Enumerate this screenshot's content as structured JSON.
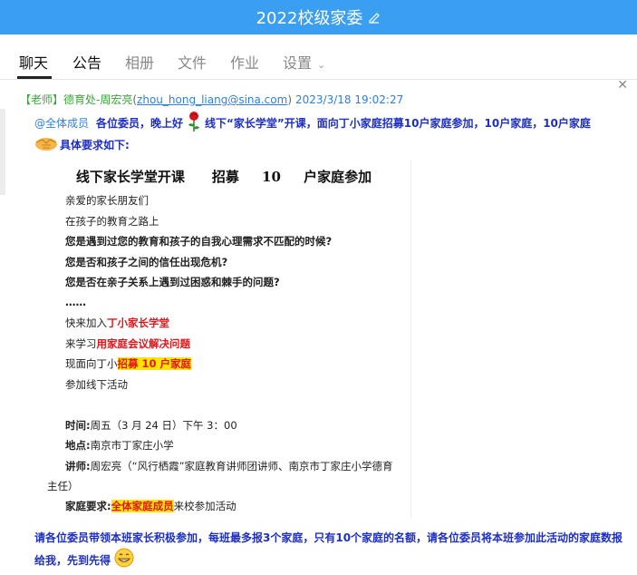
{
  "window": {
    "title": "2022校级家委"
  },
  "tabs": [
    {
      "label": "聊天"
    },
    {
      "label": "公告"
    },
    {
      "label": "相册"
    },
    {
      "label": "文件"
    },
    {
      "label": "作业"
    },
    {
      "label": "设置"
    }
  ],
  "message": {
    "role": "【老师】",
    "sender": "德育处-周宏亮",
    "email": "zhou_hong_liang@sina.com",
    "timestamp": "2023/3/18 19:02:27",
    "mention": "@全体成员",
    "line1_a": "各位委员，晚上好",
    "line1_b": "线下“家长学堂”开课，面向丁小家庭招募10户家庭参加，10户家庭，10户家庭",
    "line2": "具体要求如下:",
    "footer": "请各位委员带领本班家长积极参加，每班最多报3个家庭，只有10个家庭的名额，请各位委员将本班参加此活动的家庭数报给我，先到先得"
  },
  "poster": {
    "title": "线下家长学堂开课　　招募 10 户家庭参加",
    "greeting": "亲爱的家长朋友们",
    "intro": "在孩子的教育之路上",
    "q1": "您是遇到过您的教育和孩子的自我心理需求不匹配的时候?",
    "q2": "您是否和孩子之间的信任出现危机?",
    "q3": "您是否在亲子关系上遇到过困惑和棘手的问题?",
    "dots": "……",
    "join_prefix": "快来加入",
    "join_red": "丁小家长学堂",
    "learn_prefix": "来学习",
    "learn_red": "用家庭会议解决问题",
    "recruit_prefix": "现面向丁小",
    "recruit_hl": "招募 10 户家庭",
    "attend": "参加线下活动",
    "time_label": "时间:",
    "time_value": "周五（3 月 24 日）下午 3：00",
    "place_label": "地点:",
    "place_value": "南京市丁家庄小学",
    "lecturer_label": "讲师:",
    "lecturer_value": "周宏亮（“风行栖霞”家庭教育讲师团讲师、南京市丁家庄小学德育",
    "lecturer_cont": "主任）",
    "req_label": "家庭要求:",
    "req_hl": "全体家庭成员",
    "req_suffix": "来校参加活动"
  },
  "colors": {
    "titlebar": "#3a9ff0",
    "message_blue": "#1d2fc4",
    "link_blue": "#2f7fe0",
    "sender_green": "#3aa53a",
    "red": "#e0161b",
    "highlight": "#ffe400"
  },
  "icons": [
    "edit-pencil-icon",
    "chevron-down-icon",
    "close-icon",
    "rose-emoji-icon",
    "handshake-emoji-icon",
    "grin-emoji-icon"
  ]
}
